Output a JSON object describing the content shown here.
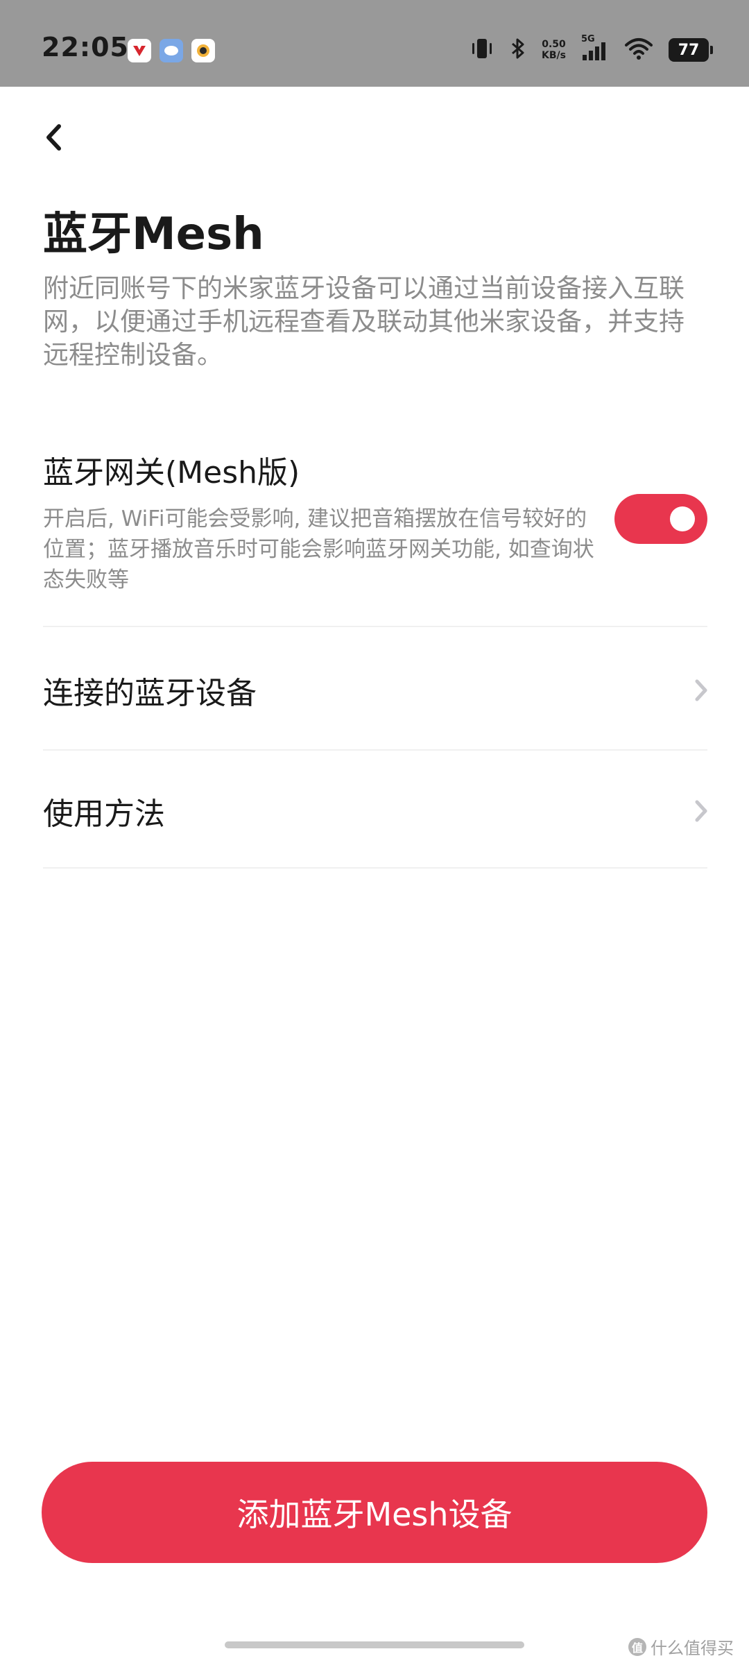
{
  "status_bar": {
    "time": "22:05",
    "net_speed_value": "0.50",
    "net_speed_unit": "KB/s",
    "signal_label": "5G",
    "battery": "77"
  },
  "header": {
    "title": "蓝牙Mesh",
    "description": "附近同账号下的米家蓝牙设备可以通过当前设备接入互联网，以便通过手机远程查看及联动其他米家设备，并支持远程控制设备。"
  },
  "gateway": {
    "title": "蓝牙网关(Mesh版)",
    "description": "开启后, WiFi可能会受影响, 建议把音箱摆放在信号较好的位置；蓝牙播放音乐时可能会影响蓝牙网关功能, 如查询状态失败等",
    "enabled": true
  },
  "list": {
    "connected_devices": "连接的蓝牙设备",
    "usage": "使用方法"
  },
  "actions": {
    "add_device": "添加蓝牙Mesh设备"
  },
  "watermark": {
    "badge": "值",
    "text": "什么值得买"
  },
  "colors": {
    "accent": "#e8364e",
    "status_bar_bg": "#999999"
  }
}
